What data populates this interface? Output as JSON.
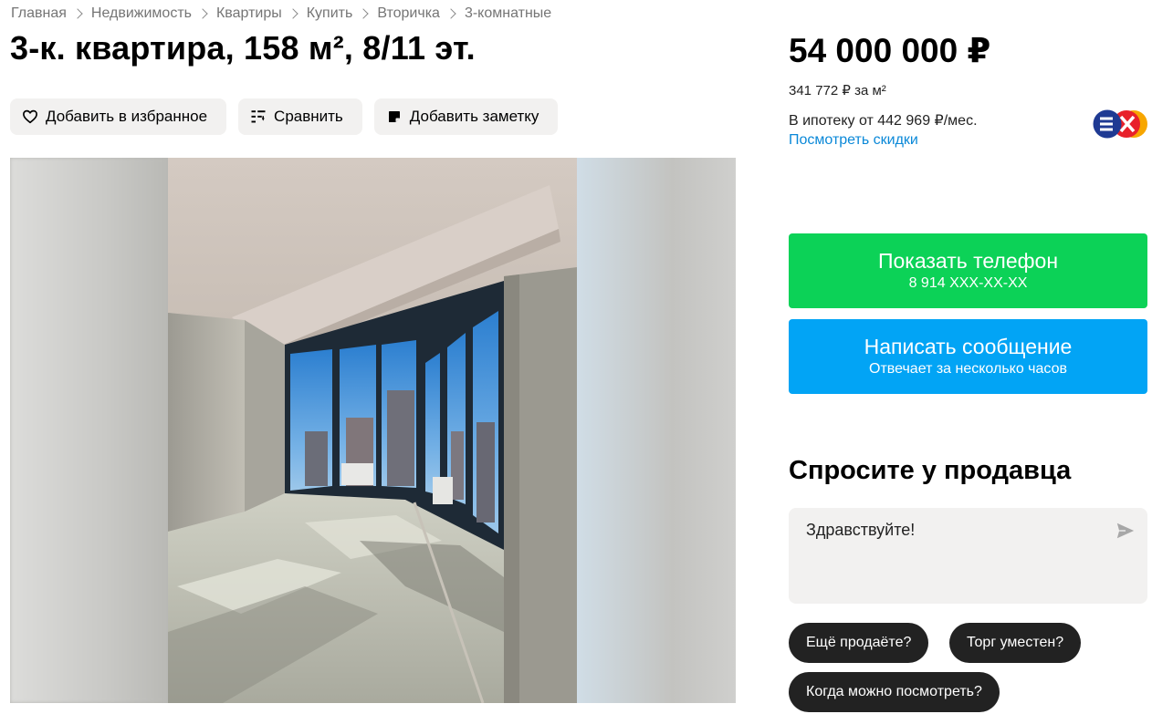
{
  "breadcrumbs": [
    "Главная",
    "Недвижимость",
    "Квартиры",
    "Купить",
    "Вторичка",
    "3-комнатные"
  ],
  "title": "3-к. квартира, 158 м², 8/11 эт.",
  "actions": {
    "favorite": "Добавить в избранное",
    "compare": "Сравнить",
    "note": "Добавить заметку"
  },
  "icons": {
    "favorite": "heart-icon",
    "compare": "compare-list-icon",
    "note": "note-icon",
    "send": "send-arrow-icon",
    "bank": "bank-logo-icon"
  },
  "price": {
    "total": "54 000 000 ₽",
    "per_m2": "341 772 ₽ за м²",
    "mortgage": "В ипотеку от 442 969 ₽/мес.",
    "discounts_link": "Посмотреть скидки"
  },
  "contact": {
    "phone_label": "Показать телефон",
    "phone_masked": "8 914 XXX-XX-XX",
    "message_label": "Написать сообщение",
    "message_sub": "Отвечает за несколько часов"
  },
  "ask": {
    "title": "Спросите у продавца",
    "message_value": "Здравствуйте!",
    "chips": [
      "Ещё продаёте?",
      "Торг уместен?",
      "Когда можно посмотреть?"
    ]
  },
  "colors": {
    "phone_button": "#0cd257",
    "message_button": "#02a4f5",
    "link": "#0a88d8",
    "chip_bg": "#222222",
    "action_bg": "#f2f1f0"
  }
}
